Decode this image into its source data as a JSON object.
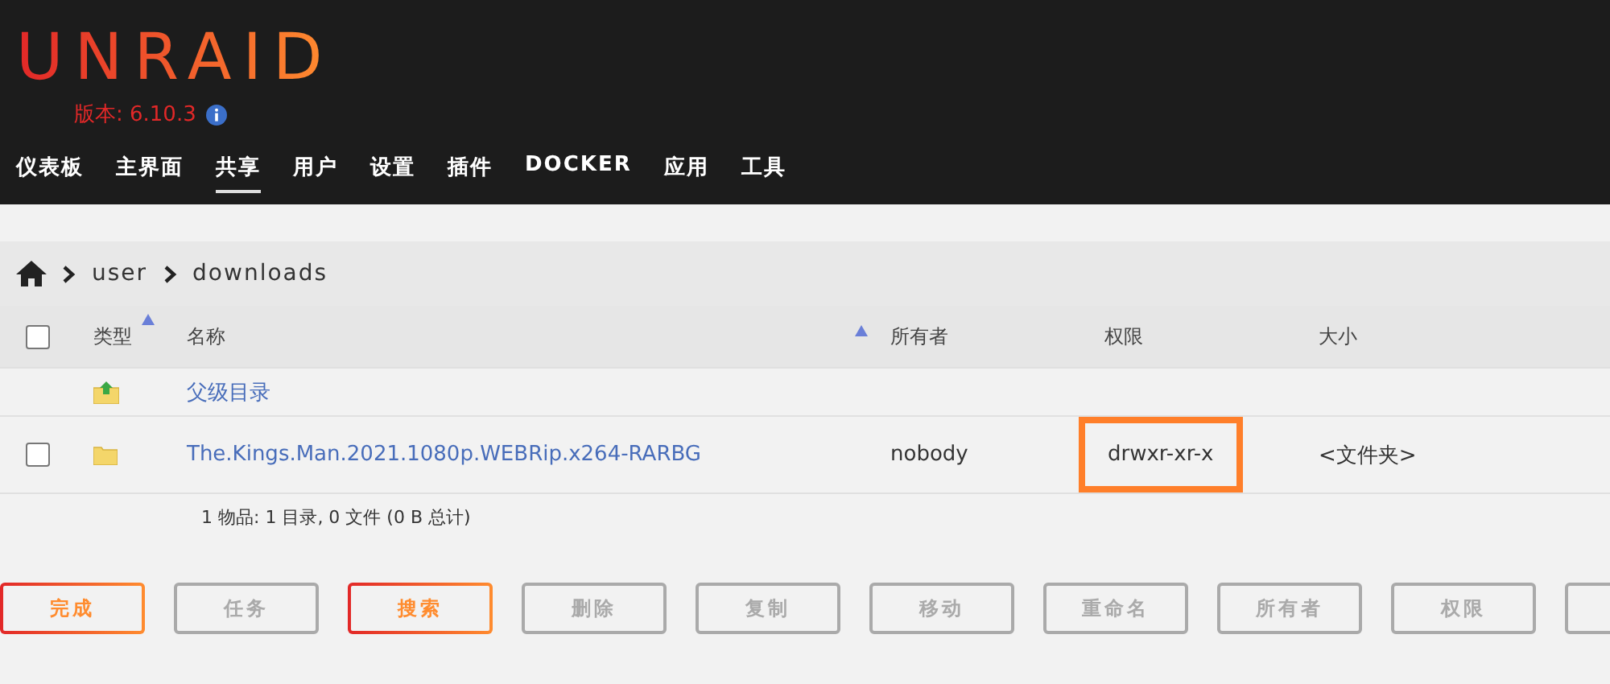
{
  "logo": {
    "text": "UNRAID",
    "version": "版本: 6.10.3"
  },
  "nav": [
    {
      "label": "仪表板",
      "selected": false
    },
    {
      "label": "主界面",
      "selected": false
    },
    {
      "label": "共享",
      "selected": true
    },
    {
      "label": "用户",
      "selected": false
    },
    {
      "label": "设置",
      "selected": false
    },
    {
      "label": "插件",
      "selected": false
    },
    {
      "label": "DOCKER",
      "selected": false
    },
    {
      "label": "应用",
      "selected": false
    },
    {
      "label": "工具",
      "selected": false
    }
  ],
  "breadcrumb": [
    "user",
    "downloads"
  ],
  "table": {
    "columns": [
      {
        "label": "类型",
        "sorted": true
      },
      {
        "label": "名称",
        "sorted": true
      },
      {
        "label": "所有者",
        "sorted": false
      },
      {
        "label": "权限",
        "sorted": false
      },
      {
        "label": "大小",
        "sorted": false
      }
    ],
    "header_checked": false,
    "rows": [
      {
        "kind": "parent",
        "name": "父级目录"
      },
      {
        "kind": "folder",
        "checked": false,
        "name": "The.Kings.Man.2021.1080p.WEBRip.x264-RARBG",
        "owner": "nobody",
        "permissions": "drwxr-xr-x",
        "permissions_highlighted": true,
        "size": "<文件夹>"
      }
    ],
    "summary": "1 物品: 1 目录, 0 文件 (0 B 总计)"
  },
  "buttons": [
    {
      "label": "完成",
      "disabled": false
    },
    {
      "label": "任务",
      "disabled": true
    },
    {
      "label": "搜索",
      "disabled": false
    },
    {
      "label": "删除",
      "disabled": true
    },
    {
      "label": "复制",
      "disabled": true
    },
    {
      "label": "移动",
      "disabled": true
    },
    {
      "label": "重命名",
      "disabled": true
    },
    {
      "label": "所有者",
      "disabled": true
    },
    {
      "label": "权限",
      "disabled": true
    },
    {
      "disabled": true
    }
  ]
}
